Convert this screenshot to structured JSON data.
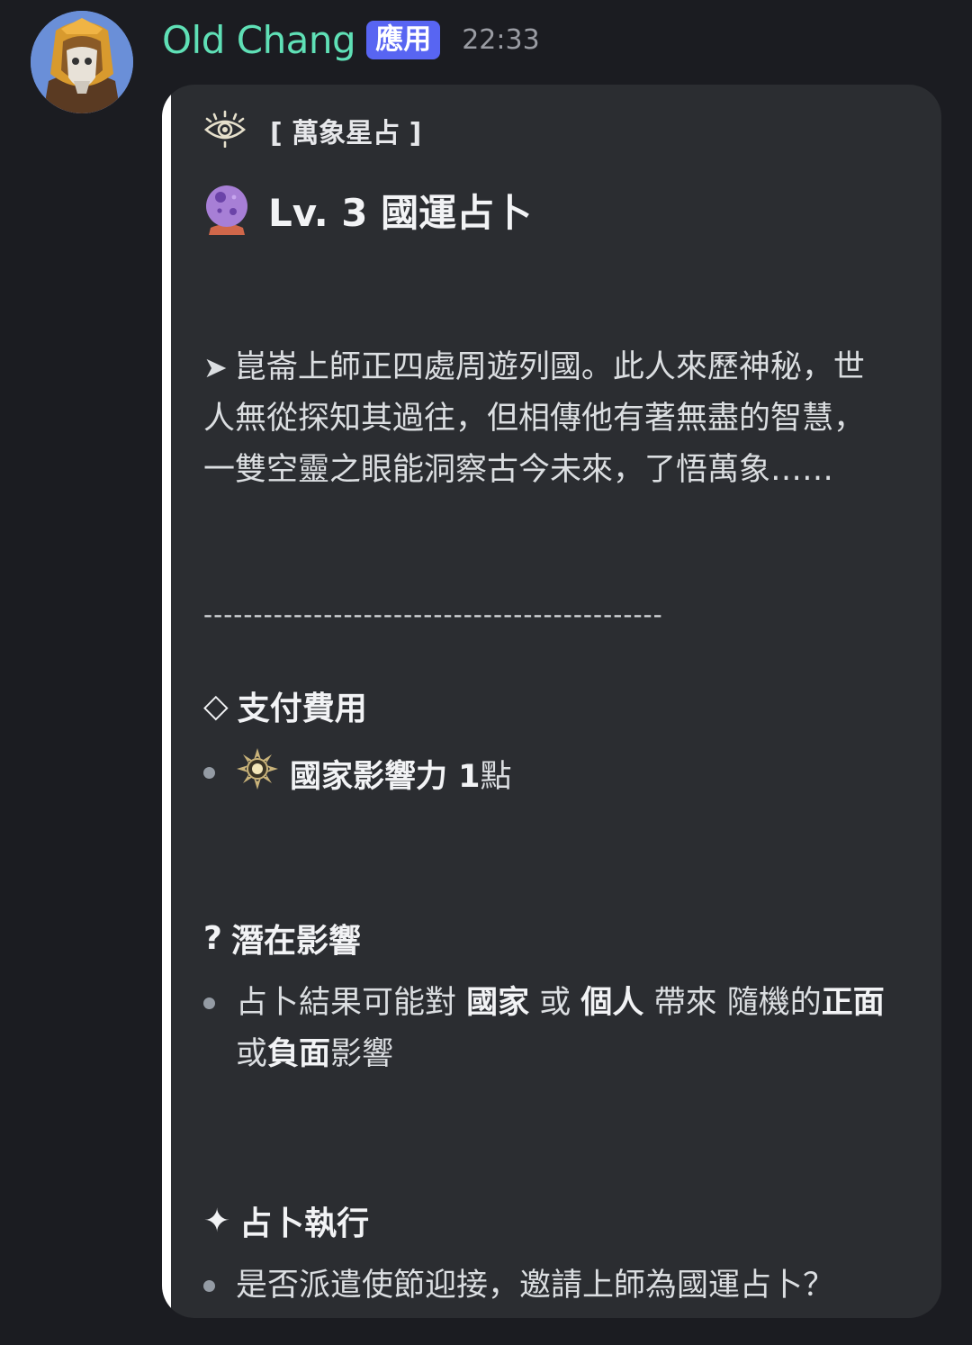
{
  "message": {
    "username": "Old Chang",
    "app_badge": "應用",
    "timestamp": "22:33"
  },
  "embed": {
    "author": "[ 萬象星占 ]",
    "title": "Lv. 3 國運占卜",
    "description_arrow": "➤",
    "description": "崑崙上師正四處周遊列國。此人來歷神秘，世人無從探知其過往，但相傳他有著無盡的智慧，一雙空靈之眼能洞察古今未來，了悟萬象……",
    "divider": "----------------------------------------------",
    "sections": {
      "cost": {
        "symbol": "◇",
        "title": "支付費用",
        "item_bold": "國家影響力 1",
        "item_tail": " 點"
      },
      "impact": {
        "symbol": "?",
        "title": "潛在影響",
        "t1": "占卜結果可能對 ",
        "b1": "國家",
        "t2": " 或 ",
        "b2": "個人",
        "t3": " 帶來 隨機的",
        "b3": "正面",
        "t4": "或",
        "b4": "負面",
        "t5": "影響"
      },
      "execute": {
        "symbol": "✦",
        "title": "占卜執行",
        "item": "是否派遣使節迎接，邀請上師為國運占卜？"
      }
    }
  },
  "icons": {
    "author_icon": "eye-icon",
    "title_icon": "crystal-ball-icon",
    "cost_icon": "sun-emblem-icon"
  },
  "colors": {
    "background": "#1b1c21",
    "embed_bg": "#2b2d31",
    "username": "#5fe0b6",
    "badge": "#5865f2",
    "embed_bar": "#ffffff"
  }
}
